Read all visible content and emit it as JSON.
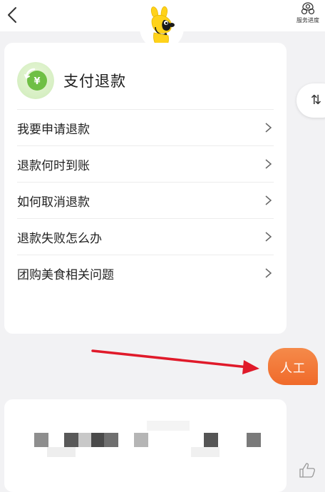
{
  "header": {
    "back_icon": "chevron-left-icon",
    "progress_label": "服务进度",
    "progress_icon": "service-progress-icon"
  },
  "mascot": {
    "icon": "kangaroo-mascot-icon"
  },
  "card": {
    "icon": "yuan-refund-icon",
    "title": "支付退款",
    "items": [
      {
        "label": "我要申请退款"
      },
      {
        "label": "退款何时到账"
      },
      {
        "label": "如何取消退款"
      },
      {
        "label": "退款失败怎么办"
      },
      {
        "label": "团购美食相关问题"
      }
    ]
  },
  "sort_chip": {
    "glyph": "⇅"
  },
  "human_button": {
    "label": "人工"
  },
  "colors": {
    "accent_orange": "#f06a2a",
    "annotation_red": "#e01a2a",
    "green": "#7cc24a"
  }
}
